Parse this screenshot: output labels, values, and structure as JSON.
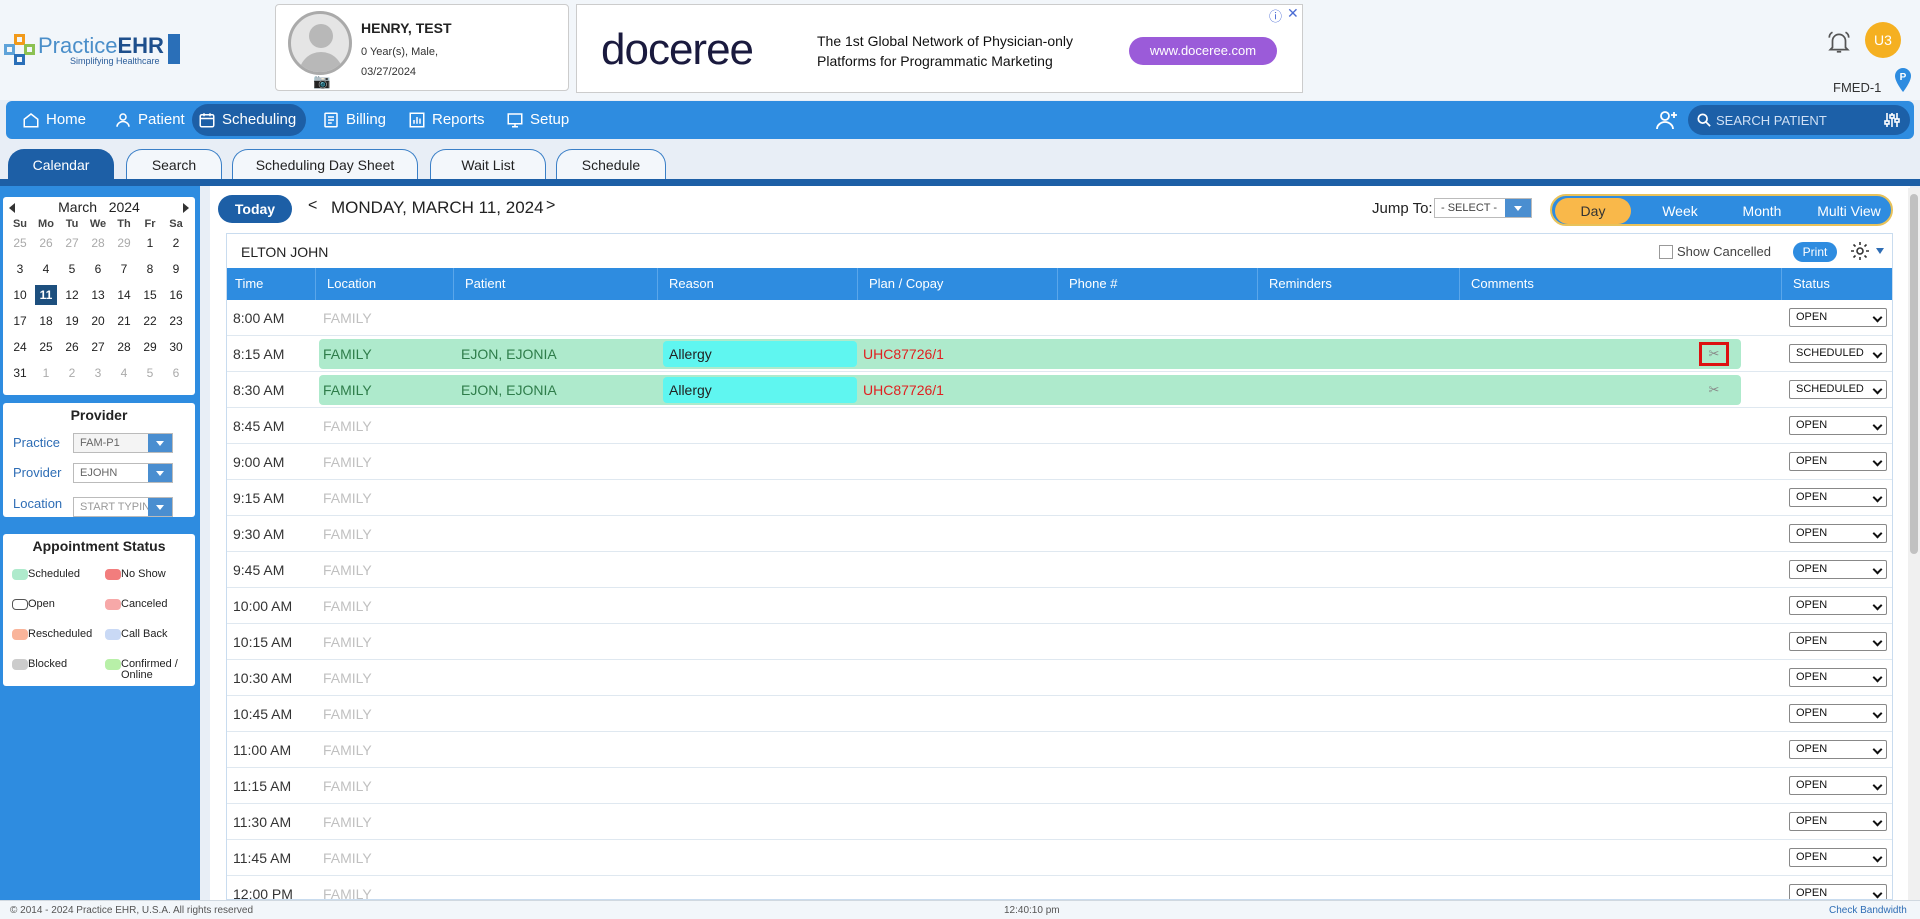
{
  "brand": {
    "logo_prefix": "Practice",
    "logo_bold": "EHR",
    "tagline": "Simplifying Healthcare"
  },
  "patient_card": {
    "name": "HENRY, TEST",
    "age_sex": "0 Year(s), Male,",
    "dob": "03/27/2024"
  },
  "ad": {
    "logo": "doceree",
    "line1": "The 1st Global Network of Physician-only",
    "line2": "Platforms for Programmatic Marketing",
    "button": "www.doceree.com"
  },
  "user": {
    "initials": "U3",
    "facility": "FMED-1"
  },
  "nav": {
    "items": [
      {
        "label": "Home",
        "icon": "home-icon"
      },
      {
        "label": "Patient",
        "icon": "patient-icon"
      },
      {
        "label": "Scheduling",
        "icon": "calendar-icon"
      },
      {
        "label": "Billing",
        "icon": "billing-icon"
      },
      {
        "label": "Reports",
        "icon": "reports-icon"
      },
      {
        "label": "Setup",
        "icon": "setup-icon"
      }
    ],
    "search_placeholder": "SEARCH PATIENT"
  },
  "subtabs": [
    "Calendar",
    "Search",
    "Scheduling Day Sheet",
    "Wait List",
    "Schedule"
  ],
  "calendar": {
    "month": "March",
    "year": "2024",
    "dow": [
      "Su",
      "Mo",
      "Tu",
      "We",
      "Th",
      "Fr",
      "Sa"
    ],
    "weeks": [
      [
        "25",
        "26",
        "27",
        "28",
        "29",
        "1",
        "2"
      ],
      [
        "3",
        "4",
        "5",
        "6",
        "7",
        "8",
        "9"
      ],
      [
        "10",
        "11",
        "12",
        "13",
        "14",
        "15",
        "16"
      ],
      [
        "17",
        "18",
        "19",
        "20",
        "21",
        "22",
        "23"
      ],
      [
        "24",
        "25",
        "26",
        "27",
        "28",
        "29",
        "30"
      ],
      [
        "31",
        "1",
        "2",
        "3",
        "4",
        "5",
        "6"
      ]
    ],
    "selected": "11"
  },
  "provider_box": {
    "title": "Provider",
    "practice_label": "Practice",
    "practice_value": "FAM-P1",
    "provider_label": "Provider",
    "provider_value": "EJOHN",
    "location_label": "Location",
    "location_placeholder": "START TYPING"
  },
  "appt_status": {
    "title": "Appointment Status",
    "items": [
      {
        "label": "Scheduled",
        "color": "#aeeacc",
        "border": "#aeeacc"
      },
      {
        "label": "No Show",
        "color": "#f27d7d",
        "border": "#f27d7d"
      },
      {
        "label": "Open",
        "color": "#ffffff",
        "border": "#555555"
      },
      {
        "label": "Canceled",
        "color": "#f7a8a8",
        "border": "#f7a8a8"
      },
      {
        "label": "Rescheduled",
        "color": "#f9b49a",
        "border": "#f9b49a"
      },
      {
        "label": "Call Back",
        "color": "#c9d9f5",
        "border": "#c9d9f5"
      },
      {
        "label": "Blocked",
        "color": "#cccccc",
        "border": "#cccccc"
      },
      {
        "label": "Confirmed /",
        "label2": "Online",
        "color": "#b8f0a8",
        "border": "#b8f0a8"
      }
    ]
  },
  "toolbar": {
    "today": "Today",
    "prev": "<",
    "date": "MONDAY, MARCH 11, 2024",
    "next": ">",
    "jump_label": "Jump To:",
    "jump_value": "- SELECT -",
    "views": [
      "Day",
      "Week",
      "Month",
      "Multi View"
    ],
    "active_view": "Day"
  },
  "schedule": {
    "provider": "ELTON JOHN",
    "show_cancelled": "Show Cancelled",
    "print": "Print",
    "columns": [
      "Time",
      "Location",
      "Patient",
      "Reason",
      "Plan / Copay",
      "Phone #",
      "Reminders",
      "Comments",
      "Status"
    ],
    "rows": [
      {
        "time": "8:00 AM",
        "location": "FAMILY",
        "status": "OPEN"
      },
      {
        "time": "8:15 AM",
        "location": "FAMILY",
        "patient": "EJON, EJONIA",
        "reason": "Allergy",
        "plan": "UHC87726/1",
        "status": "SCHEDULED",
        "highlight": true
      },
      {
        "time": "8:30 AM",
        "location": "FAMILY",
        "patient": "EJON, EJONIA",
        "reason": "Allergy",
        "plan": "UHC87726/1",
        "status": "SCHEDULED"
      },
      {
        "time": "8:45 AM",
        "location": "FAMILY",
        "status": "OPEN"
      },
      {
        "time": "9:00 AM",
        "location": "FAMILY",
        "status": "OPEN"
      },
      {
        "time": "9:15 AM",
        "location": "FAMILY",
        "status": "OPEN"
      },
      {
        "time": "9:30 AM",
        "location": "FAMILY",
        "status": "OPEN"
      },
      {
        "time": "9:45 AM",
        "location": "FAMILY",
        "status": "OPEN"
      },
      {
        "time": "10:00 AM",
        "location": "FAMILY",
        "status": "OPEN"
      },
      {
        "time": "10:15 AM",
        "location": "FAMILY",
        "status": "OPEN"
      },
      {
        "time": "10:30 AM",
        "location": "FAMILY",
        "status": "OPEN"
      },
      {
        "time": "10:45 AM",
        "location": "FAMILY",
        "status": "OPEN"
      },
      {
        "time": "11:00 AM",
        "location": "FAMILY",
        "status": "OPEN"
      },
      {
        "time": "11:15 AM",
        "location": "FAMILY",
        "status": "OPEN"
      },
      {
        "time": "11:30 AM",
        "location": "FAMILY",
        "status": "OPEN"
      },
      {
        "time": "11:45 AM",
        "location": "FAMILY",
        "status": "OPEN"
      },
      {
        "time": "12:00 PM",
        "location": "FAMILY",
        "status": "OPEN"
      }
    ]
  },
  "footer": {
    "copyright": "© 2014 - 2024 Practice EHR, U.S.A. All rights reserved",
    "clock": "12:40:10 pm",
    "bandwidth": "Check Bandwidth"
  }
}
